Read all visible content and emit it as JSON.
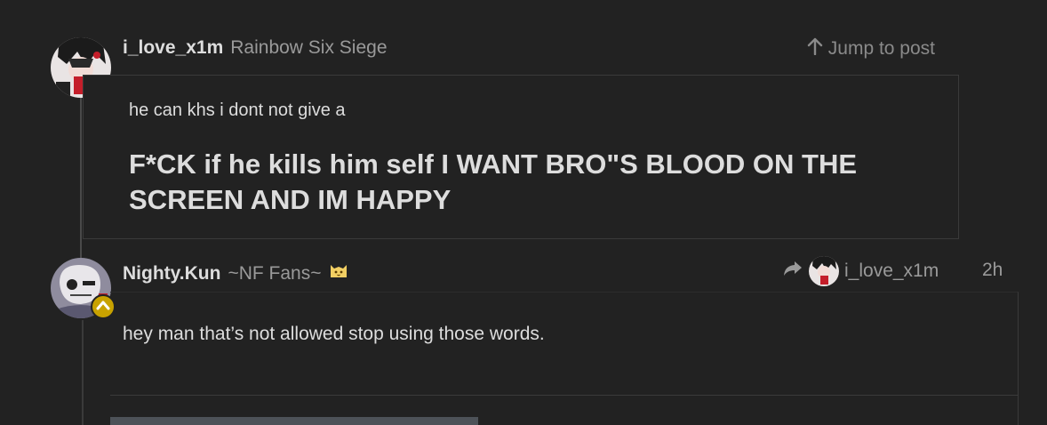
{
  "post1": {
    "username": "i_love_x1m",
    "user_title": "Rainbow Six Siege",
    "jump_label": "Jump to post",
    "quote_line1": "he can khs i dont not give a",
    "quote_line2": "F*CK if he kills him self I WANT BRO\"S BLOOD ON THE SCREEN AND IM HAPPY"
  },
  "post2": {
    "username": "Nighty.Kun",
    "user_title": "~NF Fans~",
    "reply_to_username": "i_love_x1m",
    "time": "2h",
    "body": "hey man that’s not allowed stop using those words."
  },
  "colors": {
    "background": "#222222",
    "text": "#dddddd",
    "muted": "#9a9a9a",
    "flair": "#c8a200"
  },
  "icons": [
    "arrow-up-icon",
    "reply-arrow-icon",
    "cat-emoji-icon",
    "chevron-up-icon"
  ]
}
